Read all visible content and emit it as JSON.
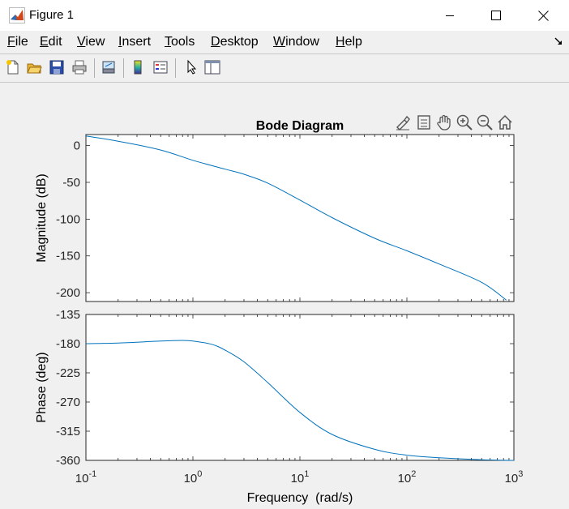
{
  "window": {
    "title": "Figure 1",
    "icons": {
      "app": "matlab-logo-icon",
      "minimize": "minimize-icon",
      "maximize": "maximize-icon",
      "close": "close-icon"
    }
  },
  "menubar": {
    "items": [
      {
        "label": "File",
        "accel": "F"
      },
      {
        "label": "Edit",
        "accel": "E"
      },
      {
        "label": "View",
        "accel": "V"
      },
      {
        "label": "Insert",
        "accel": "I"
      },
      {
        "label": "Tools",
        "accel": "T"
      },
      {
        "label": "Desktop",
        "accel": "D"
      },
      {
        "label": "Window",
        "accel": "W"
      },
      {
        "label": "Help",
        "accel": "H"
      }
    ],
    "dock_icon": "dock-arrow-icon"
  },
  "toolbar": {
    "icons": [
      "new-figure-icon",
      "open-file-icon",
      "save-icon",
      "print-icon",
      "link-plot-icon",
      "colorbar-icon",
      "legend-icon",
      "pointer-icon",
      "property-inspector-icon"
    ]
  },
  "axes_toolbar": {
    "icons": [
      "brush-icon",
      "data-tip-icon",
      "pan-icon",
      "zoom-in-icon",
      "zoom-out-icon",
      "home-icon"
    ]
  },
  "colors": {
    "line": "#0072bd",
    "axes_bg": "#ffffff",
    "figure_bg": "#f0f0f0",
    "text": "#262626"
  },
  "chart_data": {
    "type": "line",
    "title": "Bode Diagram",
    "xlabel": "Frequency  (rad/s)",
    "xscale": "log",
    "xlim": [
      0.1,
      1000
    ],
    "x_ticks": [
      {
        "base": "10",
        "exp": "-1"
      },
      {
        "base": "10",
        "exp": "0"
      },
      {
        "base": "10",
        "exp": "1"
      },
      {
        "base": "10",
        "exp": "2"
      },
      {
        "base": "10",
        "exp": "3"
      }
    ],
    "magnitude": {
      "ylabel": "Magnitude (dB)",
      "ylim": [
        -212,
        15
      ],
      "yticks": [
        "0",
        "-50",
        "-100",
        "-150",
        "-200"
      ],
      "x": [
        0.1,
        0.2,
        0.5,
        1,
        2,
        3,
        5,
        10,
        20,
        50,
        100,
        200,
        500,
        850
      ],
      "y": [
        13,
        6,
        -6,
        -20,
        -32,
        -39,
        -51,
        -74,
        -98,
        -126,
        -143,
        -161,
        -186,
        -210
      ]
    },
    "phase": {
      "ylabel": "Phase (deg)",
      "ylim": [
        -360,
        -135
      ],
      "yticks": [
        "-135",
        "-180",
        "-225",
        "-270",
        "-315",
        "-360"
      ],
      "x": [
        0.1,
        0.2,
        0.5,
        0.8,
        1,
        1.5,
        2,
        3,
        5,
        10,
        20,
        50,
        100,
        200,
        500,
        1000
      ],
      "y": [
        -180,
        -179,
        -176,
        -175,
        -176,
        -181,
        -190,
        -208,
        -240,
        -286,
        -320,
        -343,
        -352,
        -356,
        -359,
        -360
      ]
    }
  }
}
